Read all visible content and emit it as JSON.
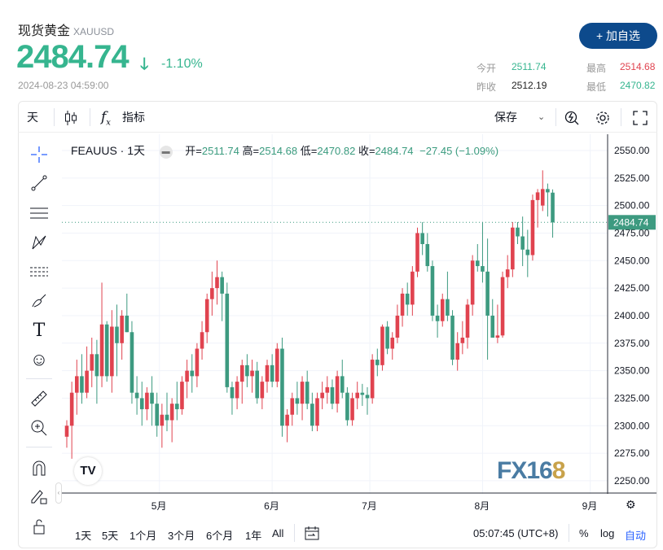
{
  "header": {
    "title": "现货黄金",
    "symbol": "XAUUSD",
    "price": "2484.74",
    "change_pct": "-1.10%",
    "timestamp": "2024-08-23 04:59:00",
    "add_button": "+ 加自选"
  },
  "stats": {
    "open_label": "今开",
    "open": "2511.74",
    "high_label": "最高",
    "high": "2514.68",
    "prev_close_label": "昨收",
    "prev_close": "2512.19",
    "low_label": "最低",
    "low": "2470.82"
  },
  "colors": {
    "up": "#e0434f",
    "down": "#3d9a80",
    "accent": "#36b58f",
    "button": "#0d4a8c",
    "high": "#e0434f"
  },
  "toolbar": {
    "interval": "天",
    "indicators": "指标",
    "save": "保存"
  },
  "legend": {
    "symbol": "FEAUUS · 1天",
    "open_label": "开=",
    "open": "2511.74",
    "high_label": "高=",
    "high": "2514.68",
    "low_label": "低=",
    "low": "2470.82",
    "close_label": "收=",
    "close": "2484.74",
    "change": "−27.45 (−1.09%)"
  },
  "chart_data": {
    "type": "candlestick",
    "title": "FEAUUS · 1天",
    "ylim": [
      2235,
      2565
    ],
    "y_ticks": [
      "2550.00",
      "2525.00",
      "2500.00",
      "2475.00",
      "2450.00",
      "2425.00",
      "2400.00",
      "2375.00",
      "2350.00",
      "2325.00",
      "2300.00",
      "2275.00",
      "2250.00"
    ],
    "x_ticks": [
      {
        "label": "5月",
        "index": 18.5
      },
      {
        "label": "6月",
        "index": 41
      },
      {
        "label": "7月",
        "index": 60.5
      },
      {
        "label": "8月",
        "index": 83
      },
      {
        "label": "9月",
        "index": 104.5
      }
    ],
    "last_price_label": "2484.74",
    "last_price": 2484.74,
    "candles": [
      [
        2290,
        2305,
        2280,
        2300
      ],
      [
        2300,
        2340,
        2270,
        2330
      ],
      [
        2330,
        2360,
        2310,
        2345
      ],
      [
        2345,
        2365,
        2320,
        2330
      ],
      [
        2330,
        2372,
        2325,
        2350
      ],
      [
        2350,
        2380,
        2335,
        2365
      ],
      [
        2365,
        2378,
        2320,
        2345
      ],
      [
        2345,
        2430,
        2335,
        2392
      ],
      [
        2392,
        2395,
        2340,
        2345
      ],
      [
        2345,
        2405,
        2330,
        2390
      ],
      [
        2390,
        2410,
        2345,
        2375
      ],
      [
        2375,
        2405,
        2360,
        2400
      ],
      [
        2400,
        2420,
        2385,
        2385
      ],
      [
        2385,
        2395,
        2320,
        2330
      ],
      [
        2330,
        2345,
        2310,
        2325
      ],
      [
        2325,
        2340,
        2300,
        2315
      ],
      [
        2315,
        2335,
        2305,
        2330
      ],
      [
        2330,
        2345,
        2300,
        2320
      ],
      [
        2320,
        2330,
        2290,
        2300
      ],
      [
        2300,
        2320,
        2280,
        2310
      ],
      [
        2310,
        2330,
        2295,
        2305
      ],
      [
        2305,
        2325,
        2285,
        2320
      ],
      [
        2320,
        2340,
        2305,
        2315
      ],
      [
        2315,
        2345,
        2310,
        2340
      ],
      [
        2340,
        2360,
        2325,
        2350
      ],
      [
        2350,
        2365,
        2330,
        2345
      ],
      [
        2345,
        2375,
        2335,
        2370
      ],
      [
        2370,
        2395,
        2360,
        2385
      ],
      [
        2385,
        2420,
        2375,
        2415
      ],
      [
        2415,
        2440,
        2400,
        2425
      ],
      [
        2425,
        2450,
        2410,
        2435
      ],
      [
        2435,
        2440,
        2395,
        2420
      ],
      [
        2420,
        2430,
        2330,
        2335
      ],
      [
        2335,
        2340,
        2310,
        2325
      ],
      [
        2325,
        2345,
        2315,
        2340
      ],
      [
        2340,
        2360,
        2320,
        2355
      ],
      [
        2355,
        2365,
        2335,
        2345
      ],
      [
        2345,
        2360,
        2330,
        2350
      ],
      [
        2350,
        2358,
        2320,
        2325
      ],
      [
        2325,
        2345,
        2315,
        2340
      ],
      [
        2340,
        2360,
        2330,
        2355
      ],
      [
        2355,
        2365,
        2335,
        2340
      ],
      [
        2340,
        2375,
        2335,
        2370
      ],
      [
        2370,
        2380,
        2290,
        2300
      ],
      [
        2300,
        2315,
        2285,
        2310
      ],
      [
        2310,
        2330,
        2300,
        2325
      ],
      [
        2325,
        2340,
        2310,
        2320
      ],
      [
        2320,
        2345,
        2305,
        2340
      ],
      [
        2340,
        2350,
        2315,
        2320
      ],
      [
        2320,
        2330,
        2295,
        2300
      ],
      [
        2300,
        2330,
        2295,
        2325
      ],
      [
        2325,
        2340,
        2315,
        2330
      ],
      [
        2330,
        2345,
        2320,
        2335
      ],
      [
        2335,
        2342,
        2315,
        2320
      ],
      [
        2320,
        2350,
        2312,
        2345
      ],
      [
        2345,
        2360,
        2325,
        2330
      ],
      [
        2330,
        2335,
        2300,
        2305
      ],
      [
        2305,
        2330,
        2300,
        2325
      ],
      [
        2325,
        2340,
        2315,
        2330
      ],
      [
        2330,
        2338,
        2318,
        2328
      ],
      [
        2328,
        2335,
        2310,
        2325
      ],
      [
        2325,
        2365,
        2320,
        2360
      ],
      [
        2360,
        2370,
        2345,
        2355
      ],
      [
        2355,
        2392,
        2350,
        2390
      ],
      [
        2390,
        2395,
        2365,
        2370
      ],
      [
        2370,
        2385,
        2360,
        2380
      ],
      [
        2380,
        2410,
        2375,
        2400
      ],
      [
        2400,
        2425,
        2390,
        2420
      ],
      [
        2420,
        2430,
        2400,
        2410
      ],
      [
        2410,
        2445,
        2400,
        2440
      ],
      [
        2440,
        2480,
        2435,
        2475
      ],
      [
        2475,
        2485,
        2455,
        2465
      ],
      [
        2465,
        2475,
        2440,
        2445
      ],
      [
        2445,
        2450,
        2395,
        2400
      ],
      [
        2400,
        2410,
        2380,
        2395
      ],
      [
        2395,
        2420,
        2390,
        2415
      ],
      [
        2415,
        2440,
        2395,
        2400
      ],
      [
        2400,
        2405,
        2355,
        2360
      ],
      [
        2360,
        2385,
        2350,
        2375
      ],
      [
        2375,
        2395,
        2365,
        2380
      ],
      [
        2380,
        2415,
        2370,
        2410
      ],
      [
        2410,
        2455,
        2400,
        2450
      ],
      [
        2450,
        2465,
        2440,
        2445
      ],
      [
        2445,
        2485,
        2430,
        2440
      ],
      [
        2440,
        2470,
        2360,
        2400
      ],
      [
        2400,
        2415,
        2380,
        2380
      ],
      [
        2380,
        2410,
        2375,
        2382
      ],
      [
        2382,
        2440,
        2380,
        2435
      ],
      [
        2435,
        2455,
        2425,
        2442
      ],
      [
        2442,
        2485,
        2435,
        2480
      ],
      [
        2480,
        2485,
        2465,
        2472
      ],
      [
        2472,
        2490,
        2445,
        2460
      ],
      [
        2460,
        2478,
        2435,
        2455
      ],
      [
        2455,
        2510,
        2450,
        2505
      ],
      [
        2505,
        2515,
        2480,
        2512
      ],
      [
        2500,
        2532,
        2495,
        2515
      ],
      [
        2515,
        2520,
        2490,
        2512
      ],
      [
        2511.74,
        2514.68,
        2470.82,
        2484.74
      ]
    ]
  },
  "watermark": "FX168",
  "bottom": {
    "ranges": [
      "1天",
      "5天",
      "1个月",
      "3个月",
      "6个月",
      "1年",
      "All"
    ],
    "clock": "05:07:45 (UTC+8)",
    "percent": "%",
    "log": "log",
    "auto": "自动"
  }
}
